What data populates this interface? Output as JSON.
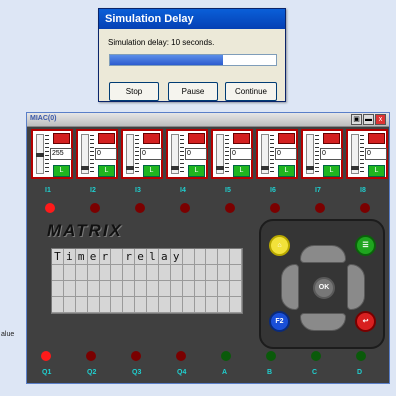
{
  "dialog": {
    "title": "Simulation Delay",
    "message": "Simulation delay: 10 seconds.",
    "progress": 0.68,
    "buttons": {
      "stop": "Stop",
      "pause": "Pause",
      "continue": "Continue"
    }
  },
  "miac": {
    "title": "MIAC(0)",
    "controls": {
      "pin": "▣",
      "minimize": "▬",
      "close": "x"
    },
    "inputs": [
      {
        "label": "I1",
        "value": "255",
        "slider": 0.55
      },
      {
        "label": "I2",
        "value": "0",
        "slider": 0.1
      },
      {
        "label": "I3",
        "value": "0",
        "slider": 0.1
      },
      {
        "label": "I4",
        "value": "0",
        "slider": 0.1
      },
      {
        "label": "I5",
        "value": "0",
        "slider": 0.1
      },
      {
        "label": "I6",
        "value": "0",
        "slider": 0.1
      },
      {
        "label": "I7",
        "value": "0",
        "slider": 0.1
      },
      {
        "label": "I8",
        "value": "0",
        "slider": 0.1
      }
    ],
    "input_button_label": "L",
    "logo": "MATRIX",
    "lcd_text": "Timer relay",
    "keypad": {
      "ok": "OK",
      "f2": "F2"
    },
    "outputs": [
      {
        "label": "Q1",
        "state": "on",
        "color": "#ff1a1a"
      },
      {
        "label": "Q2",
        "state": "off",
        "color": "#7a0000"
      },
      {
        "label": "Q3",
        "state": "off",
        "color": "#7a0000"
      },
      {
        "label": "Q4",
        "state": "off",
        "color": "#7a0000"
      },
      {
        "label": "A",
        "state": "off",
        "color": "#0a5a0a"
      },
      {
        "label": "B",
        "state": "off",
        "color": "#0a5a0a"
      },
      {
        "label": "C",
        "state": "off",
        "color": "#0a5a0a"
      },
      {
        "label": "D",
        "state": "off",
        "color": "#0a5a0a"
      }
    ],
    "top_leds": [
      "on",
      "off",
      "off",
      "off",
      "off",
      "off",
      "off",
      "off"
    ],
    "colors": {
      "label": "#1fd0d0",
      "led_on": "#ff1a1a",
      "led_off": "#7a0000"
    }
  },
  "background_label": "alue"
}
